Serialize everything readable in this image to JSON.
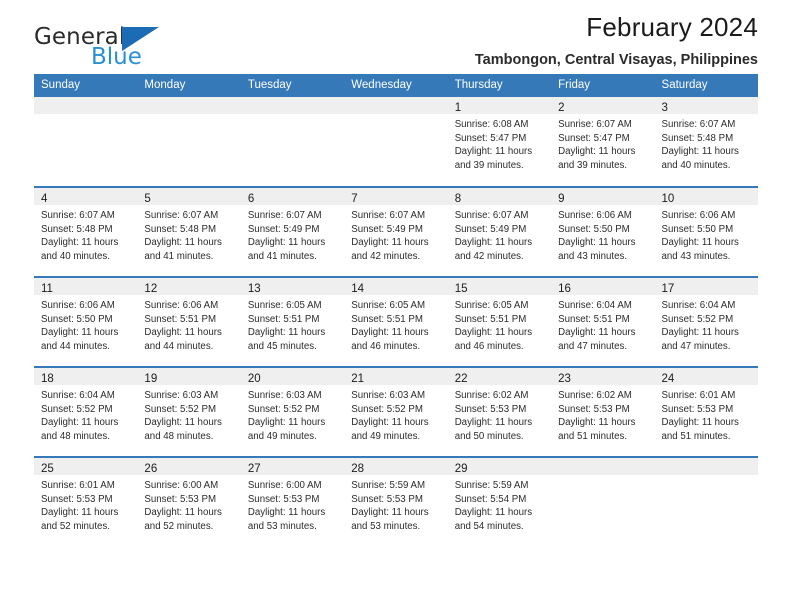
{
  "brand": {
    "word1": "General",
    "word2": "Blue",
    "triangle_color": "#1b6cb5",
    "blue_color": "#2a8fd4"
  },
  "header": {
    "title": "February 2024",
    "subtitle": "Tambongon, Central Visayas, Philippines"
  },
  "theme": {
    "header_blue": "#3679b9",
    "band_gray": "#efefef"
  },
  "weekdays": [
    "Sunday",
    "Monday",
    "Tuesday",
    "Wednesday",
    "Thursday",
    "Friday",
    "Saturday"
  ],
  "weeks": [
    [
      {
        "empty": true
      },
      {
        "empty": true
      },
      {
        "empty": true
      },
      {
        "empty": true
      },
      {
        "day": "1",
        "sunrise": "Sunrise: 6:08 AM",
        "sunset": "Sunset: 5:47 PM",
        "daylight1": "Daylight: 11 hours",
        "daylight2": "and 39 minutes."
      },
      {
        "day": "2",
        "sunrise": "Sunrise: 6:07 AM",
        "sunset": "Sunset: 5:47 PM",
        "daylight1": "Daylight: 11 hours",
        "daylight2": "and 39 minutes."
      },
      {
        "day": "3",
        "sunrise": "Sunrise: 6:07 AM",
        "sunset": "Sunset: 5:48 PM",
        "daylight1": "Daylight: 11 hours",
        "daylight2": "and 40 minutes."
      }
    ],
    [
      {
        "day": "4",
        "sunrise": "Sunrise: 6:07 AM",
        "sunset": "Sunset: 5:48 PM",
        "daylight1": "Daylight: 11 hours",
        "daylight2": "and 40 minutes."
      },
      {
        "day": "5",
        "sunrise": "Sunrise: 6:07 AM",
        "sunset": "Sunset: 5:48 PM",
        "daylight1": "Daylight: 11 hours",
        "daylight2": "and 41 minutes."
      },
      {
        "day": "6",
        "sunrise": "Sunrise: 6:07 AM",
        "sunset": "Sunset: 5:49 PM",
        "daylight1": "Daylight: 11 hours",
        "daylight2": "and 41 minutes."
      },
      {
        "day": "7",
        "sunrise": "Sunrise: 6:07 AM",
        "sunset": "Sunset: 5:49 PM",
        "daylight1": "Daylight: 11 hours",
        "daylight2": "and 42 minutes."
      },
      {
        "day": "8",
        "sunrise": "Sunrise: 6:07 AM",
        "sunset": "Sunset: 5:49 PM",
        "daylight1": "Daylight: 11 hours",
        "daylight2": "and 42 minutes."
      },
      {
        "day": "9",
        "sunrise": "Sunrise: 6:06 AM",
        "sunset": "Sunset: 5:50 PM",
        "daylight1": "Daylight: 11 hours",
        "daylight2": "and 43 minutes."
      },
      {
        "day": "10",
        "sunrise": "Sunrise: 6:06 AM",
        "sunset": "Sunset: 5:50 PM",
        "daylight1": "Daylight: 11 hours",
        "daylight2": "and 43 minutes."
      }
    ],
    [
      {
        "day": "11",
        "sunrise": "Sunrise: 6:06 AM",
        "sunset": "Sunset: 5:50 PM",
        "daylight1": "Daylight: 11 hours",
        "daylight2": "and 44 minutes."
      },
      {
        "day": "12",
        "sunrise": "Sunrise: 6:06 AM",
        "sunset": "Sunset: 5:51 PM",
        "daylight1": "Daylight: 11 hours",
        "daylight2": "and 44 minutes."
      },
      {
        "day": "13",
        "sunrise": "Sunrise: 6:05 AM",
        "sunset": "Sunset: 5:51 PM",
        "daylight1": "Daylight: 11 hours",
        "daylight2": "and 45 minutes."
      },
      {
        "day": "14",
        "sunrise": "Sunrise: 6:05 AM",
        "sunset": "Sunset: 5:51 PM",
        "daylight1": "Daylight: 11 hours",
        "daylight2": "and 46 minutes."
      },
      {
        "day": "15",
        "sunrise": "Sunrise: 6:05 AM",
        "sunset": "Sunset: 5:51 PM",
        "daylight1": "Daylight: 11 hours",
        "daylight2": "and 46 minutes."
      },
      {
        "day": "16",
        "sunrise": "Sunrise: 6:04 AM",
        "sunset": "Sunset: 5:51 PM",
        "daylight1": "Daylight: 11 hours",
        "daylight2": "and 47 minutes."
      },
      {
        "day": "17",
        "sunrise": "Sunrise: 6:04 AM",
        "sunset": "Sunset: 5:52 PM",
        "daylight1": "Daylight: 11 hours",
        "daylight2": "and 47 minutes."
      }
    ],
    [
      {
        "day": "18",
        "sunrise": "Sunrise: 6:04 AM",
        "sunset": "Sunset: 5:52 PM",
        "daylight1": "Daylight: 11 hours",
        "daylight2": "and 48 minutes."
      },
      {
        "day": "19",
        "sunrise": "Sunrise: 6:03 AM",
        "sunset": "Sunset: 5:52 PM",
        "daylight1": "Daylight: 11 hours",
        "daylight2": "and 48 minutes."
      },
      {
        "day": "20",
        "sunrise": "Sunrise: 6:03 AM",
        "sunset": "Sunset: 5:52 PM",
        "daylight1": "Daylight: 11 hours",
        "daylight2": "and 49 minutes."
      },
      {
        "day": "21",
        "sunrise": "Sunrise: 6:03 AM",
        "sunset": "Sunset: 5:52 PM",
        "daylight1": "Daylight: 11 hours",
        "daylight2": "and 49 minutes."
      },
      {
        "day": "22",
        "sunrise": "Sunrise: 6:02 AM",
        "sunset": "Sunset: 5:53 PM",
        "daylight1": "Daylight: 11 hours",
        "daylight2": "and 50 minutes."
      },
      {
        "day": "23",
        "sunrise": "Sunrise: 6:02 AM",
        "sunset": "Sunset: 5:53 PM",
        "daylight1": "Daylight: 11 hours",
        "daylight2": "and 51 minutes."
      },
      {
        "day": "24",
        "sunrise": "Sunrise: 6:01 AM",
        "sunset": "Sunset: 5:53 PM",
        "daylight1": "Daylight: 11 hours",
        "daylight2": "and 51 minutes."
      }
    ],
    [
      {
        "day": "25",
        "sunrise": "Sunrise: 6:01 AM",
        "sunset": "Sunset: 5:53 PM",
        "daylight1": "Daylight: 11 hours",
        "daylight2": "and 52 minutes."
      },
      {
        "day": "26",
        "sunrise": "Sunrise: 6:00 AM",
        "sunset": "Sunset: 5:53 PM",
        "daylight1": "Daylight: 11 hours",
        "daylight2": "and 52 minutes."
      },
      {
        "day": "27",
        "sunrise": "Sunrise: 6:00 AM",
        "sunset": "Sunset: 5:53 PM",
        "daylight1": "Daylight: 11 hours",
        "daylight2": "and 53 minutes."
      },
      {
        "day": "28",
        "sunrise": "Sunrise: 5:59 AM",
        "sunset": "Sunset: 5:53 PM",
        "daylight1": "Daylight: 11 hours",
        "daylight2": "and 53 minutes."
      },
      {
        "day": "29",
        "sunrise": "Sunrise: 5:59 AM",
        "sunset": "Sunset: 5:54 PM",
        "daylight1": "Daylight: 11 hours",
        "daylight2": "and 54 minutes."
      },
      {
        "empty": true
      },
      {
        "empty": true
      }
    ]
  ]
}
